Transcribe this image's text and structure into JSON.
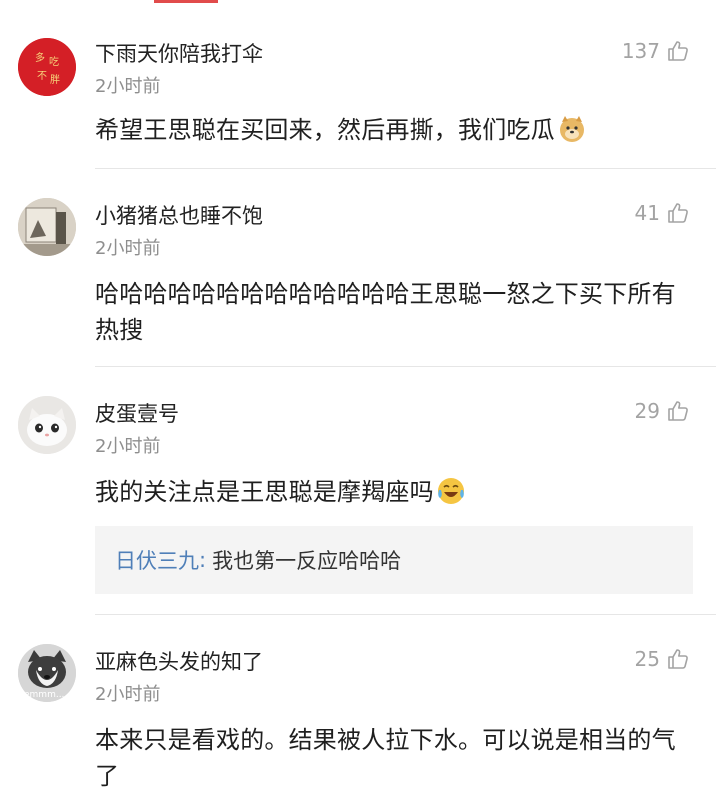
{
  "comments": [
    {
      "username": "下雨天你陪我打伞",
      "time": "2小时前",
      "likes": "137",
      "text": "希望王思聪在买回来，然后再撕，我们吃瓜",
      "avatar_text": "多吃不胖",
      "emoji": "doge-emoji"
    },
    {
      "username": "小猪猪总也睡不饱",
      "time": "2小时前",
      "likes": "41",
      "text": "哈哈哈哈哈哈哈哈哈哈哈哈哈王思聪一怒之下买下所有热搜"
    },
    {
      "username": "皮蛋壹号",
      "time": "2小时前",
      "likes": "29",
      "text": "我的关注点是王思聪是摩羯座吗",
      "emoji": "laugh-cry-emoji",
      "reply": {
        "name": "日伏三九",
        "colon": ":",
        "text": "我也第一反应哈哈哈"
      }
    },
    {
      "username": "亚麻色头发的知了",
      "time": "2小时前",
      "likes": "25",
      "text": "本来只是看戏的。结果被人拉下水。可以说是相当的气了",
      "avatar_text": "emmm..."
    }
  ],
  "colors": {
    "link": "#4f7fb8",
    "secondary": "#8e8e8e",
    "reply_bg": "#f4f4f4"
  }
}
